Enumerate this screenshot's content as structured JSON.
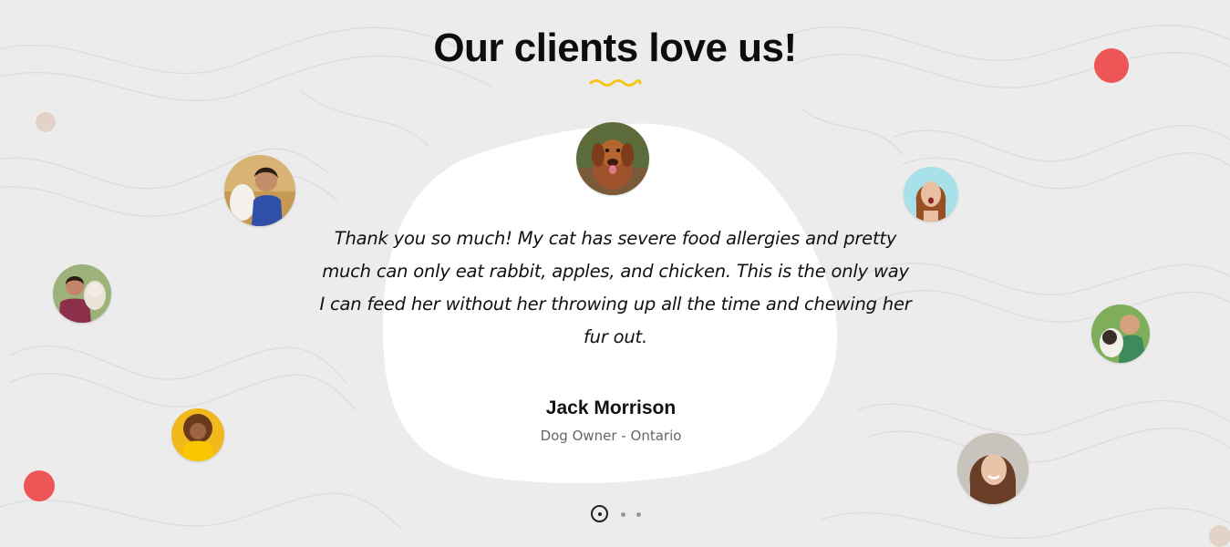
{
  "section": {
    "title": "Our clients love us!"
  },
  "colors": {
    "accent_yellow": "#f5c518",
    "dot_red": "#ee5557",
    "dot_beige": "#e2d2c8",
    "background": "#ececec"
  },
  "testimonial": {
    "quote": "Thank you so much! My cat has severe food allergies and pretty much can only eat rabbit, apples, and chicken. This is the only way I can feed her without her throwing up all the time and chewing her fur out.",
    "author": "Jack Morrison",
    "role": "Dog Owner - Ontario"
  },
  "pager": {
    "count": 3,
    "active_index": 0
  },
  "avatars": [
    "dog-avatar",
    "woman-with-dog-avatar",
    "man-with-dog-avatar",
    "woman-yellow-avatar",
    "woman-surprised-avatar",
    "man-with-puppy-avatar",
    "woman-smiling-avatar"
  ]
}
